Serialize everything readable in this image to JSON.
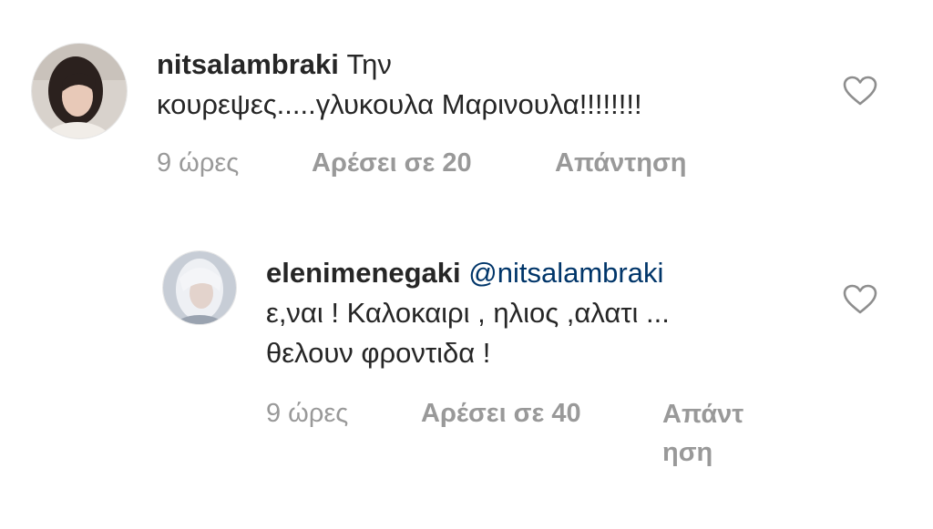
{
  "comments": [
    {
      "avatar": "avatar",
      "username": "nitsalambraki",
      "text_line1": "Την",
      "text_line2": "κουρεψες.....γλυκουλα Μαρινουλα!!!!!!!!",
      "time": "9 ώρες",
      "likes": "Αρέσει σε 20",
      "reply": "Απάντηση",
      "like_icon": "heart-outline-icon"
    },
    {
      "avatar": "avatar",
      "username": "elenimenegaki",
      "mention": "@nitsalambraki",
      "text_line2": "ε,ναι ! Καλοκαιρι , ηλιος ,αλατι ...",
      "text_line3": "θελουν φροντιδα !",
      "time": "9 ώρες",
      "likes": "Αρέσει σε 40",
      "reply_line1": "Απάντ",
      "reply_line2": "ηση",
      "like_icon": "heart-outline-icon"
    }
  ],
  "colors": {
    "text": "#262626",
    "meta": "#999999",
    "mention": "#003569",
    "heart": "#8e8e8e"
  }
}
